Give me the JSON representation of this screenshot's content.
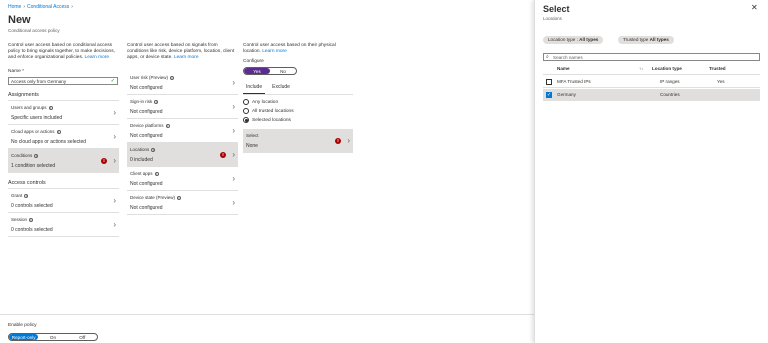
{
  "breadcrumb": {
    "home": "Home",
    "item": "Conditional Access"
  },
  "page": {
    "title": "New",
    "subtitle": "Conditional access policy"
  },
  "col1": {
    "description": "Control user access based on conditional access policy to bring signals together, to make decisions, and enforce organizational policies.",
    "learn_more": "Learn more",
    "name_label": "Name *",
    "name_value": "Access only from Germany",
    "assignments_heading": "Assignments",
    "assignments": [
      {
        "title": "Users and groups",
        "value": "Specific users included"
      },
      {
        "title": "Cloud apps or actions",
        "value": "No cloud apps or actions selected"
      },
      {
        "title": "Conditions",
        "value": "1 condition selected"
      }
    ],
    "access_controls_heading": "Access controls",
    "access_controls": [
      {
        "title": "Grant",
        "value": "0 controls selected"
      },
      {
        "title": "Session",
        "value": "0 controls selected"
      }
    ]
  },
  "col2": {
    "description": "Control user access based on signals from conditions like risk, device platform, location, client apps, or device state.",
    "learn_more": "Learn more",
    "conditions": [
      {
        "title": "User risk (Preview)",
        "value": "Not configured"
      },
      {
        "title": "Sign-in risk",
        "value": "Not configured"
      },
      {
        "title": "Device platforms",
        "value": "Not configured"
      },
      {
        "title": "Locations",
        "value": "0 included"
      },
      {
        "title": "Client apps",
        "value": "Not configured"
      },
      {
        "title": "Device state (Preview)",
        "value": "Not configured"
      }
    ]
  },
  "col3": {
    "description": "Control user access based on their physical location.",
    "learn_more": "Learn more",
    "configure_label": "Configure",
    "configure_yes": "Yes",
    "configure_no": "No",
    "tab_include": "Include",
    "tab_exclude": "Exclude",
    "radios": [
      "Any location",
      "All trusted locations",
      "Selected locations"
    ],
    "select_title": "Select",
    "select_value": "None"
  },
  "enable_policy": {
    "label": "Enable policy",
    "options": [
      "Report-only",
      "On",
      "Off"
    ]
  },
  "panel": {
    "title": "Select",
    "subtitle": "Locations",
    "filter1_label": "Location type : ",
    "filter1_value": "All types",
    "filter2_label": "Trusted type ",
    "filter2_value": "All types",
    "search_placeholder": "Search names",
    "headers": {
      "name": "Name",
      "sort": "↑↓",
      "location_type": "Location type",
      "trusted": "Trusted"
    },
    "rows": [
      {
        "name": "MFA Trusted IPs",
        "location_type": "IP ranges",
        "trusted": "Yes",
        "checked": false
      },
      {
        "name": "Germany",
        "location_type": "Countries",
        "trusted": "",
        "checked": true
      }
    ]
  },
  "colors": {
    "accent": "#0078d4",
    "toggle_on": "#5c2d91",
    "warning": "#a80000"
  },
  "icons": {
    "close": "close-icon",
    "chevron": "chevron-right-icon",
    "info": "info-icon",
    "warning": "warning-icon",
    "search": "search-icon",
    "check": "checkmark-icon"
  }
}
